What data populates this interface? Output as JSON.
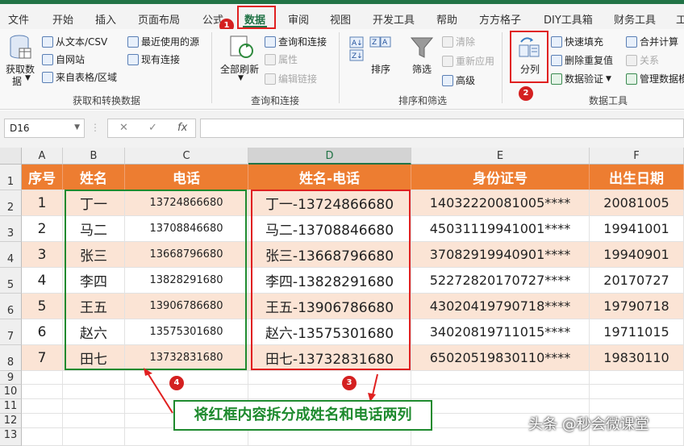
{
  "menu": {
    "items": [
      "文件",
      "开始",
      "插入",
      "页面布局",
      "公式",
      "数据",
      "审阅",
      "视图",
      "开发工具",
      "帮助",
      "方方格子",
      "DIY工具箱",
      "财务工具",
      "工"
    ],
    "active": "数据"
  },
  "ribbon": {
    "get_data": {
      "big_label_1": "获取数",
      "big_label_2": "据",
      "from_text": "从文本/CSV",
      "from_web": "自网站",
      "from_table": "来自表格/区域",
      "recent_sources": "最近使用的源",
      "existing_conn": "现有连接",
      "group_label": "获取和转换数据"
    },
    "queries": {
      "refresh_all_1": "全部刷新",
      "query_conn": "查询和连接",
      "properties": "属性",
      "edit_links": "编辑链接",
      "group_label": "查询和连接"
    },
    "sort_filter": {
      "sort": "排序",
      "filter": "筛选",
      "clear": "清除",
      "reapply": "重新应用",
      "advanced": "高级",
      "group_label": "排序和筛选"
    },
    "data_tools": {
      "split": "分列",
      "flash_fill": "快速填充",
      "remove_dup": "删除重复值",
      "validation": "数据验证",
      "consolidate": "合并计算",
      "relations": "关系",
      "data_model": "管理数据模",
      "group_label": "数据工具"
    }
  },
  "formula_bar": {
    "name_box": "D16",
    "cancel": "✕",
    "enter": "✓",
    "fx": "fx",
    "formula": ""
  },
  "columns": [
    "A",
    "B",
    "C",
    "D",
    "E",
    "F"
  ],
  "rows": [
    "1",
    "2",
    "3",
    "4",
    "5",
    "6",
    "7",
    "8",
    "9",
    "10",
    "11",
    "12",
    "13"
  ],
  "headers": [
    "序号",
    "姓名",
    "电话",
    "姓名-电话",
    "身份证号",
    "出生日期"
  ],
  "table": [
    [
      "1",
      "丁一",
      "13724866680",
      "丁一-13724866680",
      "14032220081005****",
      "20081005"
    ],
    [
      "2",
      "马二",
      "13708846680",
      "马二-13708846680",
      "45031119941001****",
      "19941001"
    ],
    [
      "3",
      "张三",
      "13668796680",
      "张三-13668796680",
      "37082919940901****",
      "19940901"
    ],
    [
      "4",
      "李四",
      "13828291680",
      "李四-13828291680",
      "52272820170727****",
      "20170727"
    ],
    [
      "5",
      "王五",
      "13906786680",
      "王五-13906786680",
      "43020419790718****",
      "19790718"
    ],
    [
      "6",
      "赵六",
      "13575301680",
      "赵六-13575301680",
      "34020819711015****",
      "19711015"
    ],
    [
      "7",
      "田七",
      "13732831680",
      "田七-13732831680",
      "65020519830110****",
      "19830110"
    ]
  ],
  "annotations": {
    "badge_1": "1",
    "badge_2": "2",
    "badge_3": "3",
    "badge_4": "4",
    "note": "将红框内容拆分成姓名和电话两列",
    "watermark": "头条 @秒会微课堂"
  },
  "colors": {
    "header_orange": "#ed7d31",
    "band_peach": "#fbe4d5",
    "excel_green": "#217346",
    "annotation_red": "#e02020",
    "annotation_green": "#1e8a2e"
  }
}
